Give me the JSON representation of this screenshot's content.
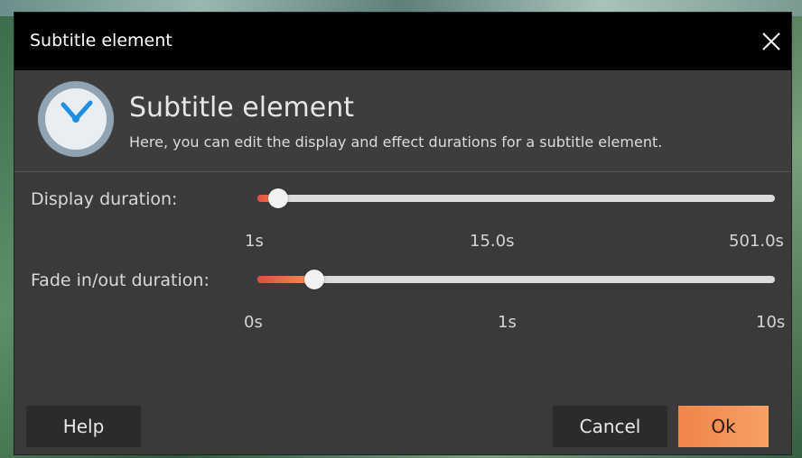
{
  "window": {
    "title": "Subtitle element",
    "close_icon": "close-icon"
  },
  "header": {
    "icon": "clock-icon",
    "title": "Subtitle element",
    "subtitle": "Here, you can edit the display and effect durations for a subtitle element."
  },
  "display_duration": {
    "label": "Display duration:",
    "value_fraction": 0.04,
    "ticks": [
      "1s",
      "15.0s",
      "501.0s"
    ]
  },
  "fade_duration": {
    "label": "Fade in/out duration:",
    "value_fraction": 0.11,
    "ticks": [
      "0s",
      "1s",
      "10s"
    ]
  },
  "buttons": {
    "help": "Help",
    "cancel": "Cancel",
    "ok": "Ok"
  },
  "colors": {
    "accent": "#f2844a",
    "titlebar": "#000000",
    "dialog_bg": "#3a3a3b"
  }
}
